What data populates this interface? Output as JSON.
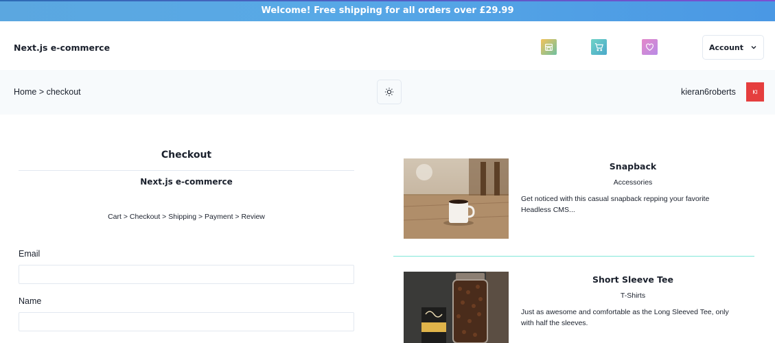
{
  "banner": {
    "text": "Welcome! Free shipping for all orders over £29.99"
  },
  "header": {
    "brand": "Next.js e-commerce",
    "icons": [
      "store-icon",
      "cart-icon",
      "heart-icon"
    ],
    "account_label": "Account"
  },
  "subbar": {
    "breadcrumb": "Home > checkout",
    "username": "kieran6roberts",
    "avatar_initials": "KI"
  },
  "checkout": {
    "title": "Checkout",
    "store_name": "Next.js e-commerce",
    "steps": "Cart > Checkout > Shipping > Payment > Review",
    "fields": [
      {
        "label": "Email",
        "value": ""
      },
      {
        "label": "Name",
        "value": ""
      }
    ]
  },
  "products": [
    {
      "name": "Snapback",
      "category": "Accessories",
      "description": "Get noticed with this casual snapback repping your favorite Headless CMS..."
    },
    {
      "name": "Short Sleeve Tee",
      "category": "T-Shirts",
      "description": "Just as awesome and comfortable as the Long Sleeved Tee, only with half the sleeves."
    }
  ],
  "colors": {
    "banner": "#58a9e6",
    "subbar_bg": "#f7fafc",
    "avatar": "#e53e3e",
    "product_divider": "#81e6d9"
  }
}
